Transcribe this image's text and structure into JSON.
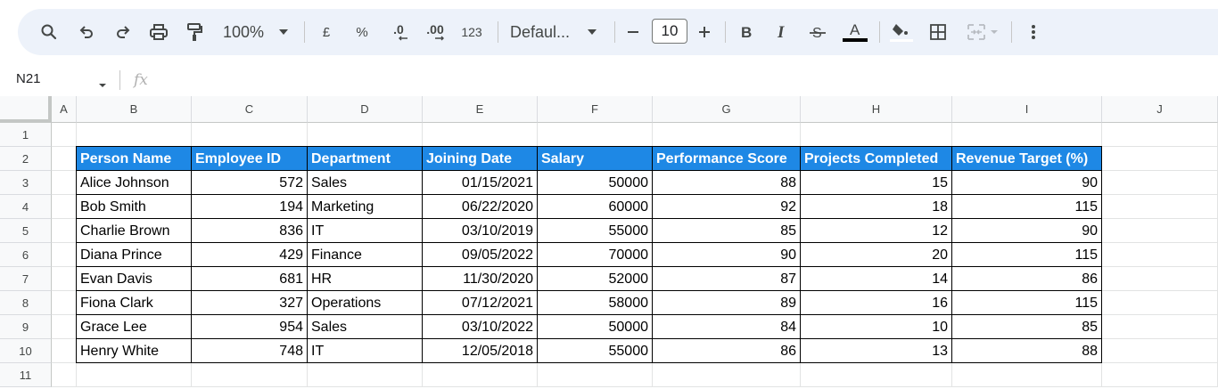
{
  "toolbar": {
    "zoom": "100%",
    "currency": "£",
    "percent": "%",
    "dec_decrease": ".0",
    "dec_increase": ".00",
    "number_format": "123",
    "font": "Defaul...",
    "font_size": "10",
    "accent_color": "#1e88e5"
  },
  "formula_bar": {
    "cell_ref": "N21",
    "fx": "fx"
  },
  "columns": [
    "A",
    "B",
    "C",
    "D",
    "E",
    "F",
    "G",
    "H",
    "I",
    "J"
  ],
  "rows": [
    "1",
    "2",
    "3",
    "4",
    "5",
    "6",
    "7",
    "8",
    "9",
    "10",
    "11"
  ],
  "table": {
    "headers": [
      "Person Name",
      "Employee ID",
      "Department",
      "Joining Date",
      "Salary",
      "Performance Score",
      "Projects Completed",
      "Revenue Target (%)"
    ],
    "rows": [
      [
        "Alice Johnson",
        "572",
        "Sales",
        "01/15/2021",
        "50000",
        "88",
        "15",
        "90"
      ],
      [
        "Bob Smith",
        "194",
        "Marketing",
        "06/22/2020",
        "60000",
        "92",
        "18",
        "115"
      ],
      [
        "Charlie Brown",
        "836",
        "IT",
        "03/10/2019",
        "55000",
        "85",
        "12",
        "90"
      ],
      [
        "Diana Prince",
        "429",
        "Finance",
        "09/05/2022",
        "70000",
        "90",
        "20",
        "115"
      ],
      [
        "Evan Davis",
        "681",
        "HR",
        "11/30/2020",
        "52000",
        "87",
        "14",
        "86"
      ],
      [
        "Fiona Clark",
        "327",
        "Operations",
        "07/12/2021",
        "58000",
        "89",
        "16",
        "115"
      ],
      [
        "Grace Lee",
        "954",
        "Sales",
        "03/10/2022",
        "50000",
        "84",
        "10",
        "85"
      ],
      [
        "Henry White",
        "748",
        "IT",
        "12/05/2018",
        "55000",
        "86",
        "13",
        "88"
      ]
    ]
  }
}
